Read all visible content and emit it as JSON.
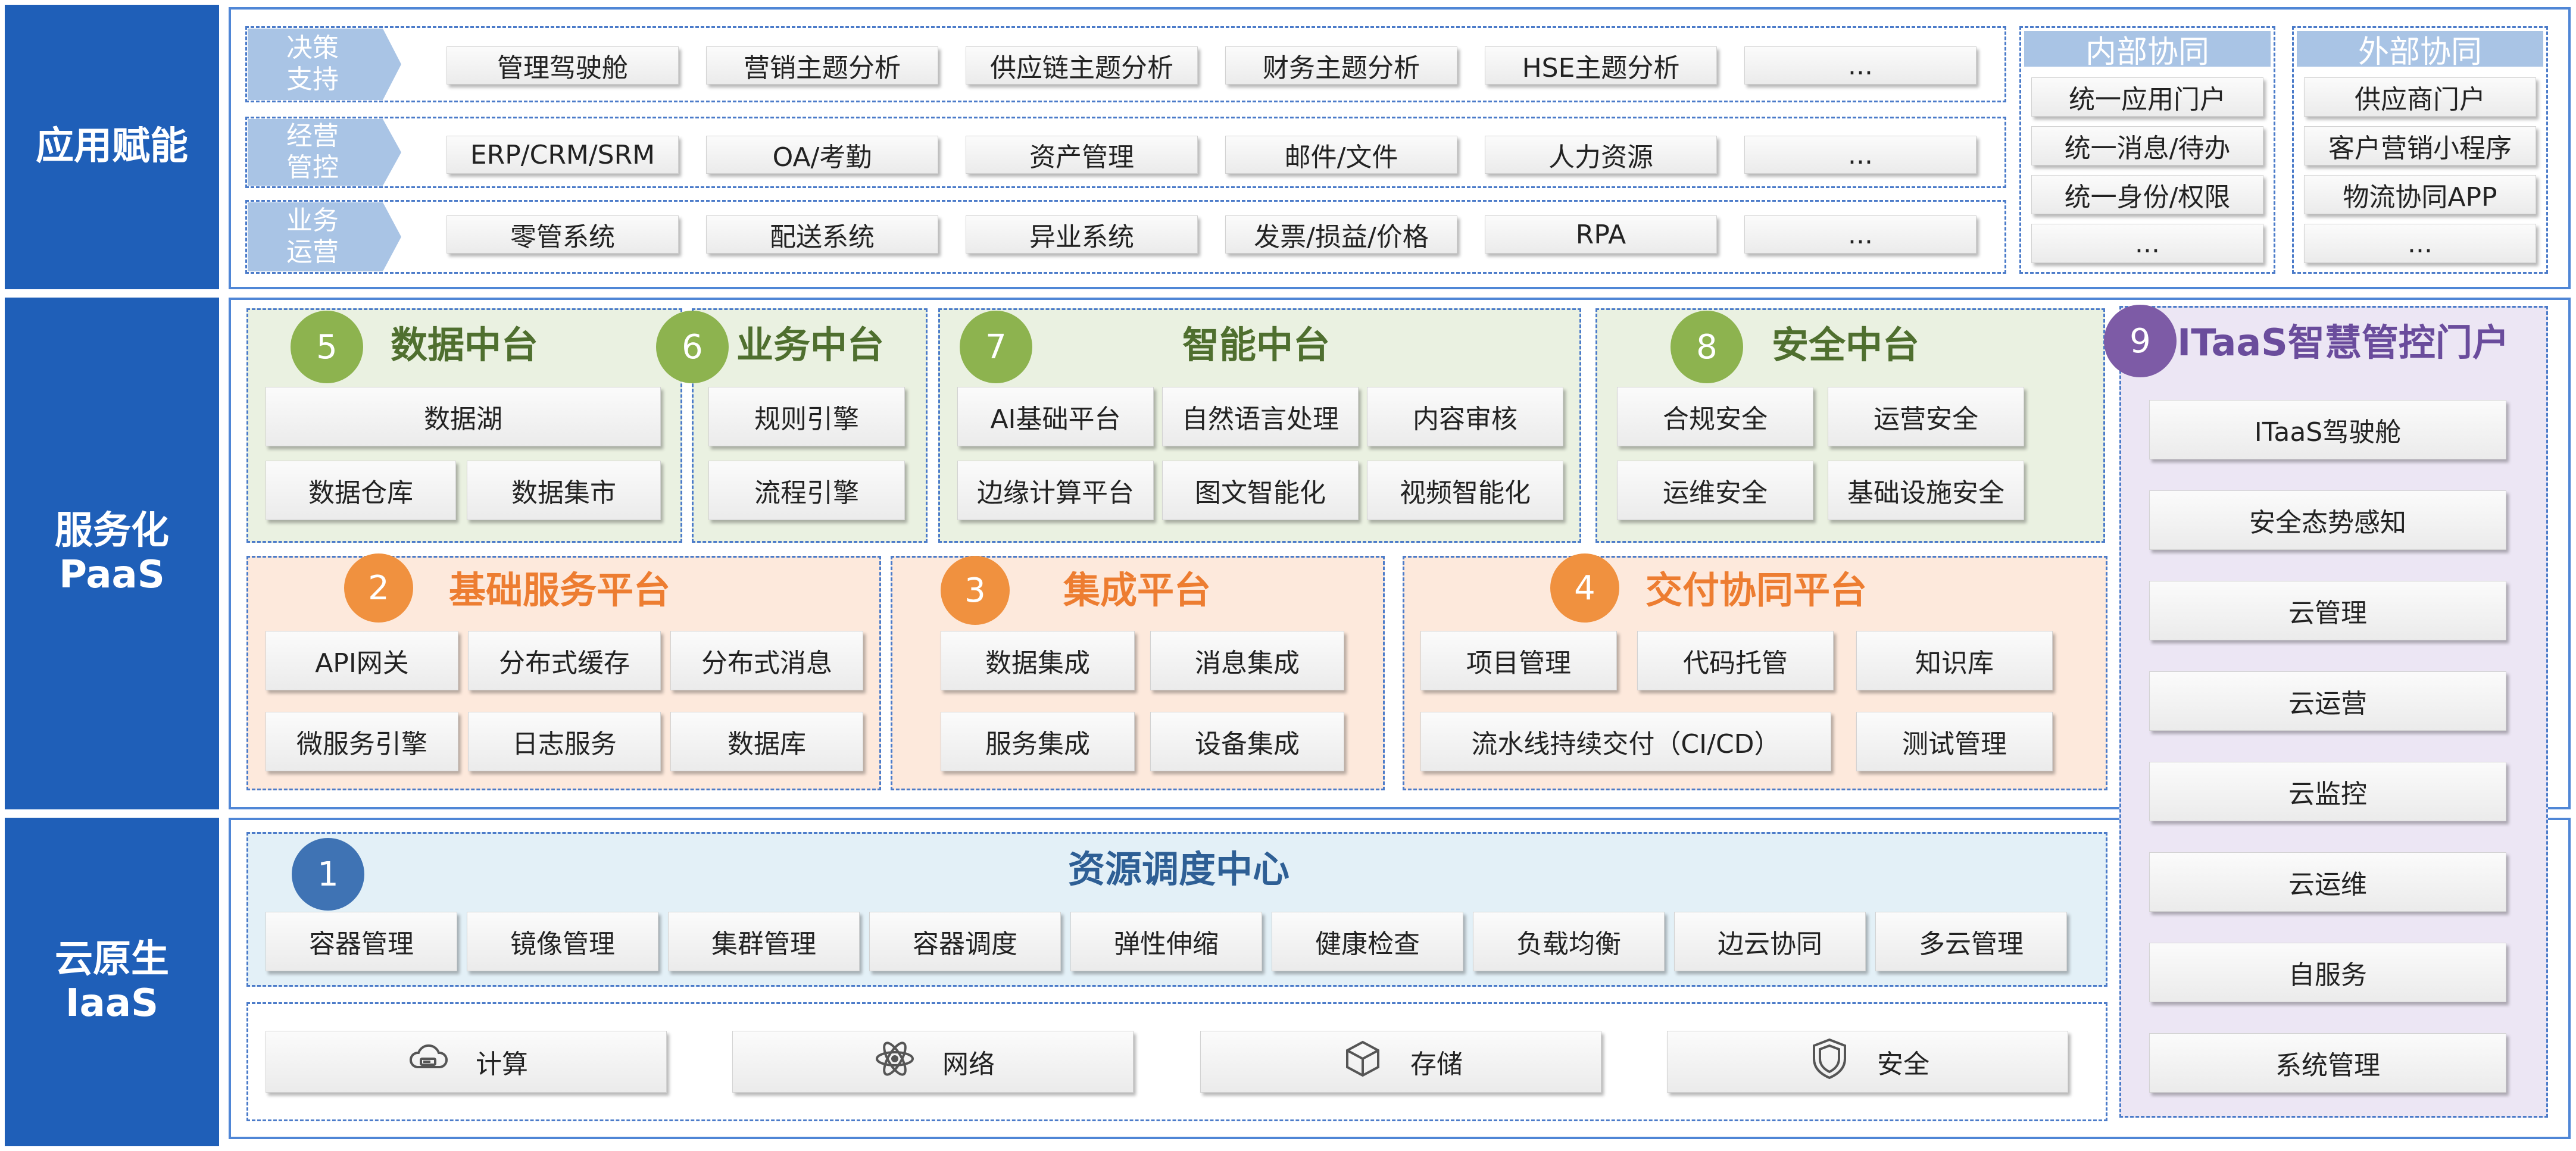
{
  "layers": {
    "app": "应用赋能",
    "paas": "服务化\nPaaS",
    "iaas": "云原生\nIaaS"
  },
  "app_layer": {
    "rows": [
      {
        "tag": "决策\n支持",
        "items": [
          "管理驾驶舱",
          "营销主题分析",
          "供应链主题分析",
          "财务主题分析",
          "HSE主题分析",
          "..."
        ]
      },
      {
        "tag": "经营\n管控",
        "items": [
          "ERP/CRM/SRM",
          "OA/考勤",
          "资产管理",
          "邮件/文件",
          "人力资源",
          "..."
        ]
      },
      {
        "tag": "业务\n运营",
        "items": [
          "零管系统",
          "配送系统",
          "异业系统",
          "发票/损益/价格",
          "RPA",
          "..."
        ]
      }
    ],
    "internal": {
      "title": "内部协同",
      "items": [
        "统一应用门户",
        "统一消息/待办",
        "统一身份/权限",
        "..."
      ]
    },
    "external": {
      "title": "外部协同",
      "items": [
        "供应商门户",
        "客户营销小程序",
        "物流协同APP",
        "..."
      ]
    }
  },
  "data_platform": {
    "num": "5",
    "title": "数据中台",
    "items": [
      "数据湖",
      "数据仓库",
      "数据集市"
    ]
  },
  "business_platform": {
    "num": "6",
    "title": "业务中台",
    "items": [
      "规则引擎",
      "流程引擎"
    ]
  },
  "ai_platform": {
    "num": "7",
    "title": "智能中台",
    "items": [
      "AI基础平台",
      "自然语言处理",
      "内容审核",
      "边缘计算平台",
      "图文智能化",
      "视频智能化"
    ]
  },
  "security_platform": {
    "num": "8",
    "title": "安全中台",
    "items": [
      "合规安全",
      "运营安全",
      "运维安全",
      "基础设施安全"
    ]
  },
  "itaas_portal": {
    "num": "9",
    "title": "ITaaS智慧管控门户",
    "items": [
      "ITaaS驾驶舱",
      "安全态势感知",
      "云管理",
      "云运营",
      "云监控",
      "云运维",
      "自服务",
      "系统管理"
    ]
  },
  "base_service": {
    "num": "2",
    "title": "基础服务平台",
    "items": [
      "API网关",
      "分布式缓存",
      "分布式消息",
      "微服务引擎",
      "日志服务",
      "数据库"
    ]
  },
  "integration": {
    "num": "3",
    "title": "集成平台",
    "items": [
      "数据集成",
      "消息集成",
      "服务集成",
      "设备集成"
    ]
  },
  "delivery": {
    "num": "4",
    "title": "交付协同平台",
    "items": [
      "项目管理",
      "代码托管",
      "知识库",
      "流水线持续交付（CI/CD）",
      "测试管理"
    ]
  },
  "resource_center": {
    "num": "1",
    "title": "资源调度中心",
    "items": [
      "容器管理",
      "镜像管理",
      "集群管理",
      "容器调度",
      "弹性伸缩",
      "健康检查",
      "负载均衡",
      "边云协同",
      "多云管理"
    ]
  },
  "infra": [
    {
      "label": "计算",
      "icon": "cloud-server-icon"
    },
    {
      "label": "网络",
      "icon": "network-atom-icon"
    },
    {
      "label": "存储",
      "icon": "storage-box-icon"
    },
    {
      "label": "安全",
      "icon": "shield-icon"
    }
  ],
  "colors": {
    "brand_blue": "#1f5fb8",
    "green": "#8db34f",
    "orange": "#f0913f",
    "purple": "#7d5ba6",
    "tag_blue": "#a9c4e5"
  }
}
